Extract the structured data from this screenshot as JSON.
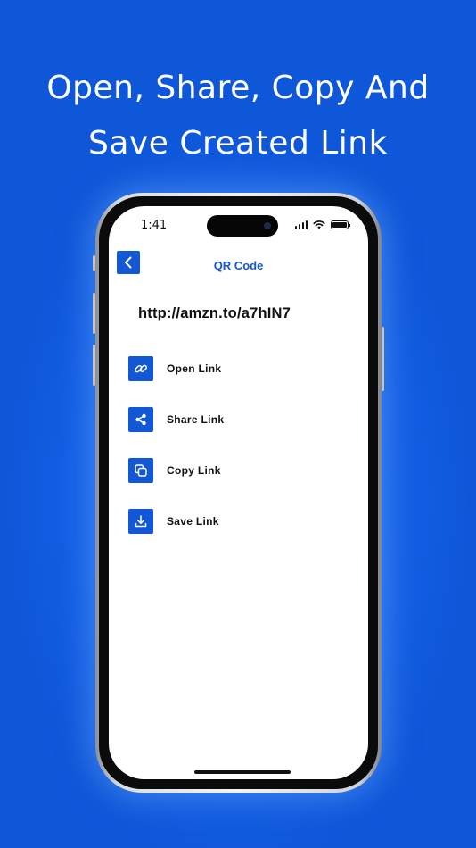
{
  "headline": "Open, Share, Copy And\nSave  Created Link",
  "status_bar": {
    "time": "1:41"
  },
  "nav": {
    "title": "QR Code",
    "back_icon": "chevron-left-icon"
  },
  "link": {
    "url": "http://amzn.to/a7hIN7"
  },
  "actions": [
    {
      "label": "Open Link",
      "icon": "link-icon"
    },
    {
      "label": "Share Link",
      "icon": "share-icon"
    },
    {
      "label": "Copy Link",
      "icon": "copy-icon"
    },
    {
      "label": "Save Link",
      "icon": "download-icon"
    }
  ],
  "colors": {
    "accent": "#1257d6",
    "background": "#1766f0"
  }
}
